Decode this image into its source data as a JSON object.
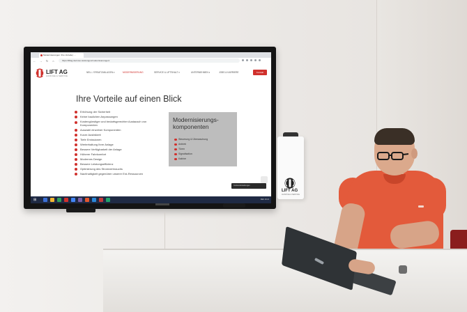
{
  "browser": {
    "tab_title": "Modernisierungen: Ihre Vorteile | ...",
    "url": "https://liftag.de/unser-leistungen/modernisierungen/"
  },
  "site": {
    "logo_text": "LIFT AG",
    "logo_sub": "AUFZÜGE & SERVICE",
    "nav": [
      {
        "label": "NEU- / ERSATZANLAGEN ▾",
        "active": false
      },
      {
        "label": "MODERNISIERUNG",
        "active": true
      },
      {
        "label": "SERVICE & LIFTSHALT ▾",
        "active": false
      },
      {
        "label": "UNTERNEHMEN ▾",
        "active": false
      },
      {
        "label": "JOBS & KARRIERE",
        "active": false
      }
    ],
    "cta_label": "Kontakt"
  },
  "page": {
    "headline": "Ihre Vorteile auf einen Blick",
    "benefits": [
      "Erhöhung der Sicherheit",
      "Keine baulichen Anpassungen",
      "Kostengünstiger und bedarfsgerechter Austausch von Komponenten",
      "Auswahl einzelner Komponenten",
      "Kurze Ausfallzeit",
      "Tiefe Emissionen",
      "Werterhaltung Ihrer Anlage",
      "Bessere Verfügbarkeit der Anlage",
      "Höherer Fahrkomfort",
      "Modernes Design",
      "Bessere Leistungseffizienz",
      "Optimierung des Stromverbrauchs",
      "Nachhaltigkeit gegenüber unserer Erd-Ressourcen"
    ],
    "panel": {
      "title": "Modernisierungs-komponenten",
      "items": [
        "Steuerung & Überwachung",
        "Antrieb",
        "Türen",
        "Signalisation",
        "Kabine"
      ]
    },
    "cookie_text": "Cookie-Einstellungen"
  },
  "taskbar": {
    "tray_text": "DEU 10:21"
  },
  "wall_sign": {
    "text": "LIFT AG",
    "sub": "AUFZÜGE & SERVICE"
  },
  "colors": {
    "brand_red": "#d0312d",
    "shirt": "#e35a3b"
  }
}
